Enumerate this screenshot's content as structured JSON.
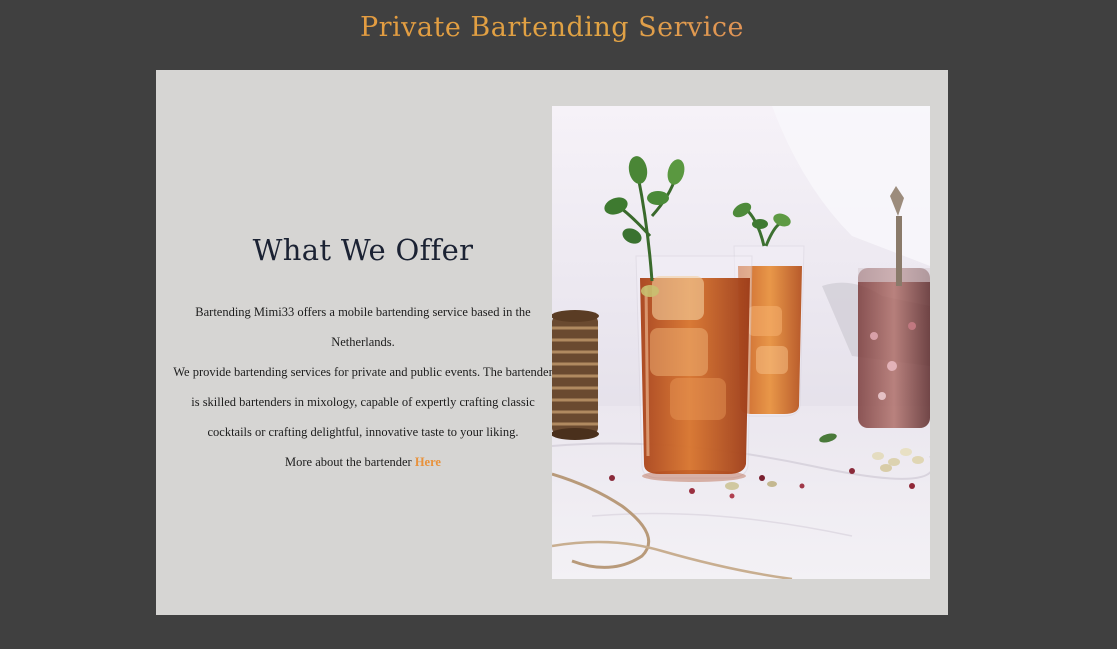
{
  "header": {
    "title": "Private Bartending Service"
  },
  "offer": {
    "heading": "What We Offer",
    "paragraph_1": "Bartending Mimi33 offers a mobile bartending service based in the Netherlands.",
    "paragraph_2": "We provide bartending services for private and public events. The bartender is skilled bartenders in mixology, capable of expertly crafting classic cocktails or crafting delightful, innovative taste to your liking.",
    "more_text": "More about the bartender ",
    "more_link": "Here"
  },
  "colors": {
    "page_background": "#404040",
    "card_background": "#d6d5d3",
    "accent": "#e8923c",
    "heading": "#1b2233"
  }
}
